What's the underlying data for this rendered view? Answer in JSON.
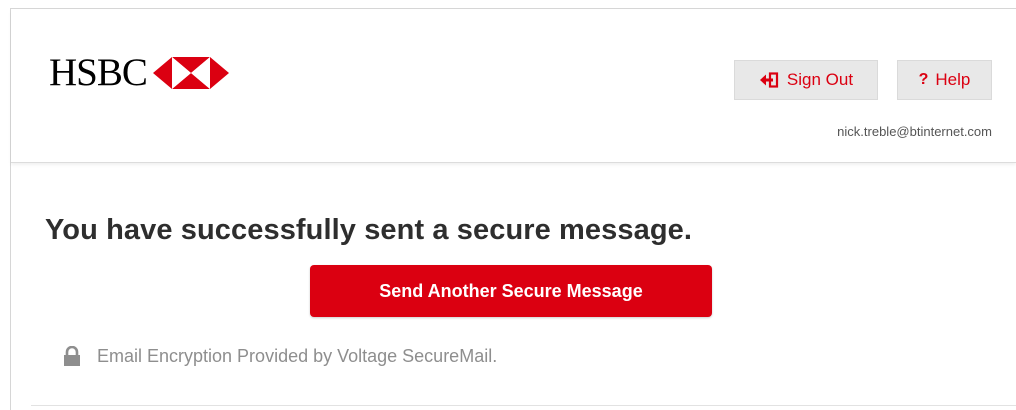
{
  "header": {
    "logo_text": "HSBC",
    "sign_out_label": "Sign Out",
    "help_label": "Help",
    "help_glyph": "?",
    "user_email": "nick.treble@btinternet.com"
  },
  "main": {
    "title": "You have successfully sent a secure message.",
    "send_another_label": "Send Another Secure Message",
    "footer_note": "Email Encryption Provided by Voltage SecureMail."
  },
  "icons": {
    "logo": "hsbc-hexagon-icon",
    "sign_out": "sign-out-icon",
    "help": "help-icon",
    "lock": "lock-icon"
  },
  "colors": {
    "brand_red": "#db0011",
    "title_text": "#2e2e2e",
    "muted_text": "#8e8e8e",
    "header_button_bg": "#e8e8e8"
  }
}
